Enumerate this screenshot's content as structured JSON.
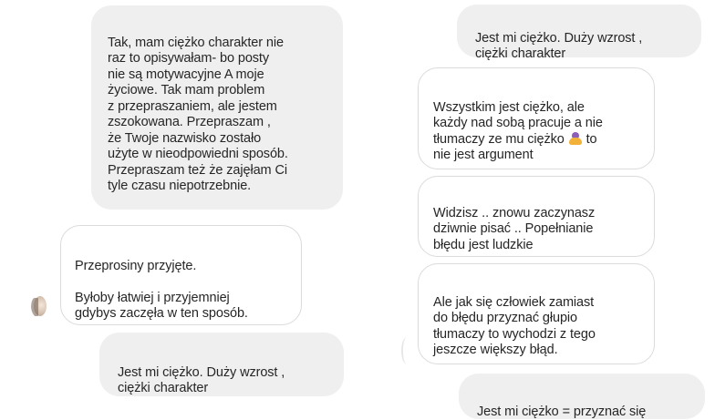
{
  "conversation": {
    "left_column": {
      "msg_1": "Tak, mam ciężko charakter nie\nraz to opisywałam- bo posty\nnie są motywacyjne A moje\nżyciowe. Tak mam problem\nz przepraszaniem, ale jestem\nzszokowana.  Przepraszam ,\nże Twoje nazwisko zostało\nużyte w nieodpowiedni sposób.\nPrzepraszam też że zajęłam Ci\ntyle czasu niepotrzebnie.",
      "msg_2": "Przeprosiny przyjęte.\n\nByłoby łatwiej i przyjemniej\ngdybys zaczęła w ten sposób.",
      "msg_3": "Jest mi ciężko.  Duży wzrost ,\nciężki charakter"
    },
    "right_column": {
      "msg_1": "Jest mi ciężko.  Duży wzrost ,\nciężki charakter",
      "msg_2_line_1": "Wszystkim jest ciężko, ale\nkażdy nad sobą pracuje a nie\ntłumaczy ze mu ciężko ",
      "msg_2_line_1_tail": " to\nnie jest argument",
      "msg_3": "Widzisz .. znowu zaczynasz\ndziwnie pisać .. Popełnianie\nbłędu jest ludzkie",
      "msg_4": "Ale jak się człowiek zamiast\ndo błędu przyznać głupio\ntłumaczy to wychodzi z tego\njeszcze większy błąd.",
      "msg_5": "Jest mi ciężko = przyznać się"
    }
  },
  "colors": {
    "sent_bubble": "#efefef",
    "received_border": "#dbdbdb",
    "text": "#262626"
  },
  "icons": {
    "emoji": "money-bag-emoji",
    "avatar": "profile-avatar"
  }
}
